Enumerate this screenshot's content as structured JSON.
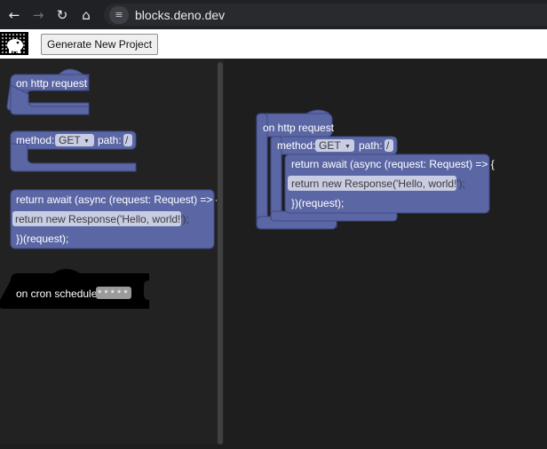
{
  "browser": {
    "url": "blocks.deno.dev",
    "back_icon": "←",
    "forward_icon": "→",
    "reload_icon": "↻",
    "home_icon": "⌂",
    "site_info_icon": "≡"
  },
  "toolbar": {
    "generate_label": "Generate New Project"
  },
  "flyout": {
    "http_request": "on http request",
    "method_label": "method:",
    "method_value": "GET",
    "path_label": "path:",
    "path_value": "/",
    "return_await": "return await (async (request: Request) => {",
    "return_response": "return new Response('Hello, world!');",
    "close_request": "})(request);",
    "cron_label": "on cron schedule",
    "cron_value": "* * * * *"
  },
  "workspace": {
    "http_request": "on http request",
    "method_label": "method:",
    "method_value": "GET",
    "path_label": "path:",
    "path_value": "/",
    "return_await": "return await (async (request: Request) => {",
    "return_response": "return new Response('Hello, world!');",
    "close_request": "})(request);"
  },
  "colors": {
    "block": "#5b67a5",
    "workspace": "#1e1e1e",
    "flyout": "#222222"
  }
}
